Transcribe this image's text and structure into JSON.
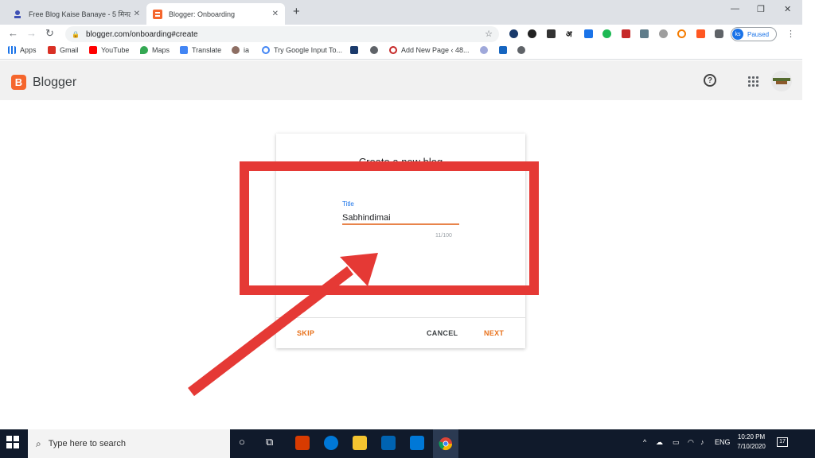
{
  "browser": {
    "tabs": [
      {
        "title": "Free Blog Kaise Banaye - 5 मिनट",
        "favicon": "site-icon",
        "active": false
      },
      {
        "title": "Blogger: Onboarding",
        "favicon": "blogger-icon",
        "active": true
      }
    ],
    "url": "blogger.com/onboarding#create",
    "profile": {
      "initials": "ks",
      "status": "Paused"
    },
    "bookmarks": [
      {
        "label": "Apps",
        "icon": "apps-grid-icon"
      },
      {
        "label": "Gmail",
        "icon": "gmail-icon"
      },
      {
        "label": "YouTube",
        "icon": "youtube-icon"
      },
      {
        "label": "Maps",
        "icon": "maps-icon"
      },
      {
        "label": "Translate",
        "icon": "translate-icon"
      },
      {
        "label": "ia",
        "icon": "ia-icon"
      },
      {
        "label": "Try Google Input To...",
        "icon": "google-icon"
      },
      {
        "label": "",
        "icon": "flag-icon"
      },
      {
        "label": "",
        "icon": "globe-icon"
      },
      {
        "label": "Add New Page ‹ 48...",
        "icon": "wordpress-icon"
      },
      {
        "label": "",
        "icon": "site-icon"
      },
      {
        "label": "",
        "icon": "video-icon"
      },
      {
        "label": "",
        "icon": "globe-icon"
      }
    ],
    "ext_hindi": "अ"
  },
  "blogger": {
    "brand": "Blogger",
    "logo_letter": "B",
    "help_glyph": "?"
  },
  "dialog": {
    "title": "Create a new blog",
    "field_label": "Title",
    "field_value": "Sabhindimai",
    "char_count": "11/100",
    "skip": "SKIP",
    "cancel": "CANCEL",
    "next": "NEXT"
  },
  "taskbar": {
    "search_placeholder": "Type here to search",
    "language": "ENG",
    "time": "10:20 PM",
    "date": "7/10/2020",
    "notifications": "17"
  },
  "colors": {
    "accent": "#e8711b",
    "blogger_orange": "#f5662d",
    "annotation_red": "#e53935",
    "link_blue": "#1a73e8"
  }
}
